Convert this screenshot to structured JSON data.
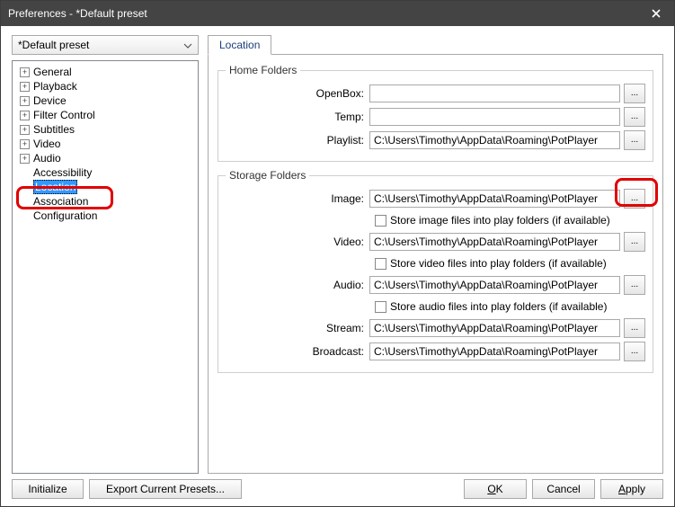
{
  "window": {
    "title": "Preferences - *Default preset"
  },
  "preset": {
    "value": "*Default preset"
  },
  "tree": [
    {
      "label": "General",
      "expandable": true
    },
    {
      "label": "Playback",
      "expandable": true
    },
    {
      "label": "Device",
      "expandable": true
    },
    {
      "label": "Filter Control",
      "expandable": true
    },
    {
      "label": "Subtitles",
      "expandable": true
    },
    {
      "label": "Video",
      "expandable": true
    },
    {
      "label": "Audio",
      "expandable": true
    },
    {
      "label": "Accessibility",
      "expandable": false
    },
    {
      "label": "Location",
      "expandable": false,
      "selected": true
    },
    {
      "label": "Association",
      "expandable": false
    },
    {
      "label": "Configuration",
      "expandable": false
    }
  ],
  "tab": {
    "label": "Location"
  },
  "home": {
    "legend": "Home Folders",
    "openbox": {
      "label": "OpenBox:",
      "value": ""
    },
    "temp": {
      "label": "Temp:",
      "value": ""
    },
    "playlist": {
      "label": "Playlist:",
      "value": "C:\\Users\\Timothy\\AppData\\Roaming\\PotPlayer"
    }
  },
  "storage": {
    "legend": "Storage Folders",
    "image": {
      "label": "Image:",
      "value": "C:\\Users\\Timothy\\AppData\\Roaming\\PotPlayer",
      "check": "Store image files into play folders (if available)"
    },
    "video": {
      "label": "Video:",
      "value": "C:\\Users\\Timothy\\AppData\\Roaming\\PotPlayer",
      "check": "Store video files into play folders (if available)"
    },
    "audio": {
      "label": "Audio:",
      "value": "C:\\Users\\Timothy\\AppData\\Roaming\\PotPlayer",
      "check": "Store audio files into play folders (if available)"
    },
    "stream": {
      "label": "Stream:",
      "value": "C:\\Users\\Timothy\\AppData\\Roaming\\PotPlayer"
    },
    "broadcast": {
      "label": "Broadcast:",
      "value": "C:\\Users\\Timothy\\AppData\\Roaming\\PotPlayer"
    }
  },
  "browse_label": "...",
  "buttons": {
    "initialize": "Initialize",
    "export": "Export Current Presets...",
    "ok": "OK",
    "cancel": "Cancel",
    "apply": "Apply"
  }
}
